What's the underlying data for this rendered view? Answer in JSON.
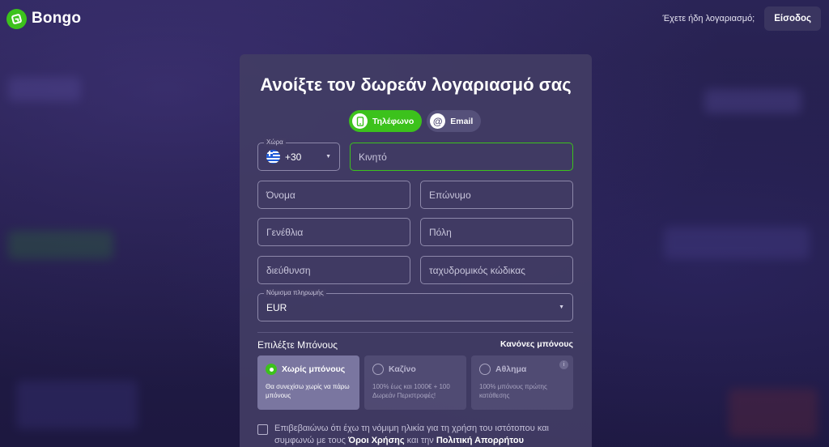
{
  "header": {
    "brand": "Bongo",
    "have_account": "Έχετε ήδη λογαριασμό;",
    "login_label": "Είσοδος"
  },
  "form": {
    "title": "Ανοίξτε τον δωρεάν λογαριασμό σας",
    "tabs": [
      {
        "label": "Τηλέφωνο",
        "icon": "phone-icon",
        "active": true
      },
      {
        "label": "Email",
        "icon": "at-icon",
        "active": false
      }
    ],
    "country_legend": "Χώρα",
    "country_code": "+30",
    "country_flag": "greece-flag",
    "mobile_placeholder": "Κινητό",
    "first_name_placeholder": "Όνομα",
    "last_name_placeholder": "Επώνυμο",
    "birthday_placeholder": "Γενέθλια",
    "city_placeholder": "Πόλη",
    "address_placeholder": "διεύθυνση",
    "postcode_placeholder": "ταχυδρομικός κώδικας",
    "currency_legend": "Νόμισμα πληρωμής",
    "currency_value": "EUR"
  },
  "bonus": {
    "title": "Επιλέξτε Μπόνους",
    "rules_link": "Κανόνες μπόνους",
    "options": [
      {
        "label": "Χωρίς μπόνους",
        "desc": "Θα συνεχίσω χωρίς να πάρω μπόνους",
        "selected": true
      },
      {
        "label": "Καζίνο",
        "desc": "100% έως και 1000€ + 100 Δωρεάν Περιστροφές!",
        "selected": false
      },
      {
        "label": "Αθλημα",
        "desc": "100% μπόνους πρώτης κατάθεσης",
        "selected": false
      }
    ]
  },
  "consent": {
    "text_1": "Επιβεβαιώνω ότι έχω τη νόμιμη ηλικία για τη χρήση του ιστότοπου και συμφωνώ με τους ",
    "terms_link": "Όροι Χρήσης",
    "text_2": " και την ",
    "privacy_link": "Πολιτική Απορρήτου"
  },
  "colors": {
    "accent": "#3cc21c",
    "card_bg": "#423c64",
    "page_bg": "#221d48"
  }
}
